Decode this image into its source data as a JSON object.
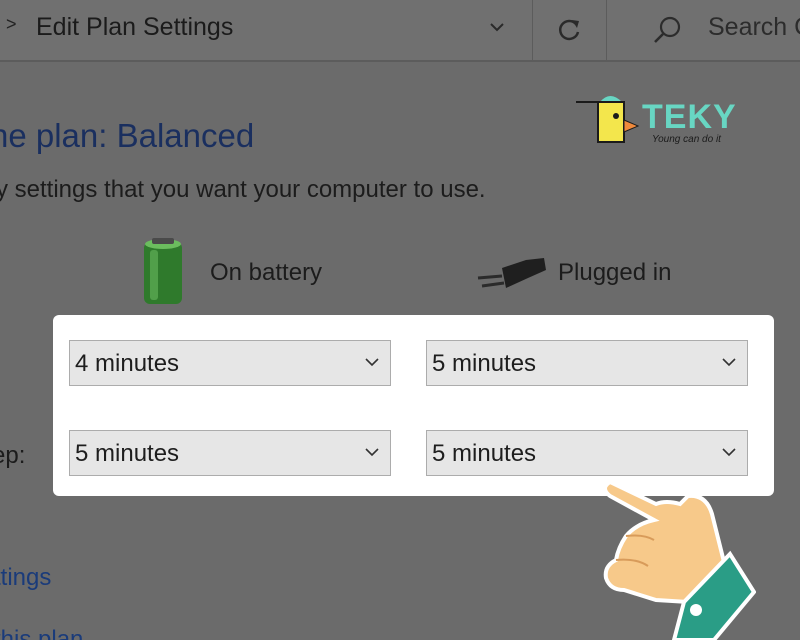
{
  "address_bar": {
    "breadcrumb_chevron": ">",
    "location": "Edit Plan Settings",
    "dropdown_icon": "chevron-down-icon",
    "refresh_icon": "refresh-icon",
    "search_placeholder": "Search C"
  },
  "plan": {
    "title": "he plan: Balanced",
    "subtitle": "y settings that you want your computer to use."
  },
  "logo": {
    "word": "TEKY",
    "tagline": "Young can do it"
  },
  "columns": {
    "on_battery": "On battery",
    "plugged_in": "Plugged in"
  },
  "settings": {
    "row1": {
      "label": "",
      "on_battery": "4 minutes",
      "plugged_in": "5 minutes"
    },
    "row2": {
      "label": "ep:",
      "on_battery": "5 minutes",
      "plugged_in": "5 minutes"
    }
  },
  "links": {
    "change_settings": "ttings",
    "restore_defaults": "this plan"
  },
  "colors": {
    "title_blue": "#1a2f5f",
    "link_blue": "#1a3b7a",
    "panel_bg": "#ffffff",
    "dim_overlay": "#6b6b6b",
    "logo_teal": "#68d6c3",
    "logo_yellow": "#f3e64c"
  }
}
